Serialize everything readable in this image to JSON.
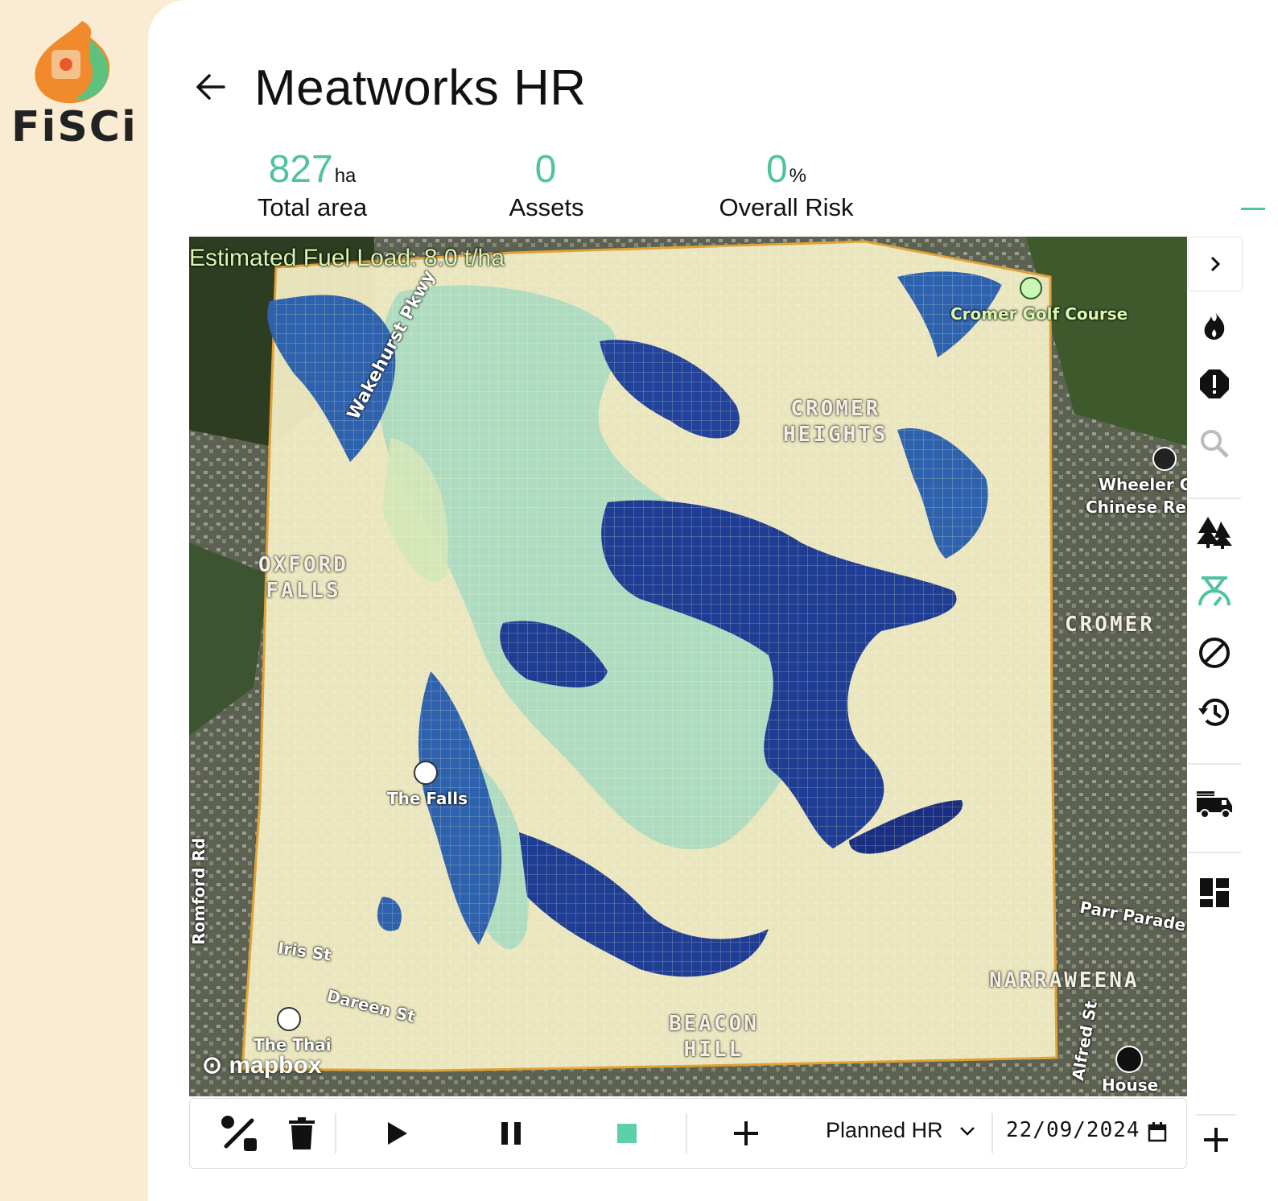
{
  "app": {
    "logo_text": "FiSCi"
  },
  "header": {
    "title": "Meatworks HR"
  },
  "stats": [
    {
      "value": "827",
      "unit": "ha",
      "label": "Total area"
    },
    {
      "value": "0",
      "unit": "",
      "label": "Assets"
    },
    {
      "value": "0",
      "unit": "%",
      "label": "Overall Risk"
    }
  ],
  "map": {
    "fuel_load_label": "Estimated Fuel Load: 8.0 t/ha",
    "attribution": "mapbox",
    "places": {
      "cromer_golf": "Cromer Golf Course",
      "wakehurst": "Wakehurst Pkwy",
      "the_falls": "The Falls",
      "wheeler_1": "Wheeler Ga",
      "wheeler_2": "Chinese Res",
      "iris": "Iris St",
      "dareen": "Dareen St",
      "the_thai": "The Thai",
      "parr": "Parr Parade",
      "alfred": "Alfred St",
      "house": "House",
      "romford": "Romford Rd"
    },
    "suburbs": {
      "cromer_heights": "CROMER\nHEIGHTS",
      "oxford_falls": "OXFORD\nFALLS",
      "cromer": "CROMER",
      "narraweena": "NARRAWEENA",
      "beacon_hill": "BEACON\nHILL"
    }
  },
  "toolbar": {
    "plan_type": "Planned HR",
    "date": "22/09/2024"
  },
  "colors": {
    "accent": "#4fc3a1",
    "sidebar_bg": "#f9ecd2",
    "fuel_low": "#f4efc6",
    "fuel_mid": "#a9d9c0",
    "fuel_high": "#2f62ad",
    "fuel_max": "#1a2f80"
  }
}
